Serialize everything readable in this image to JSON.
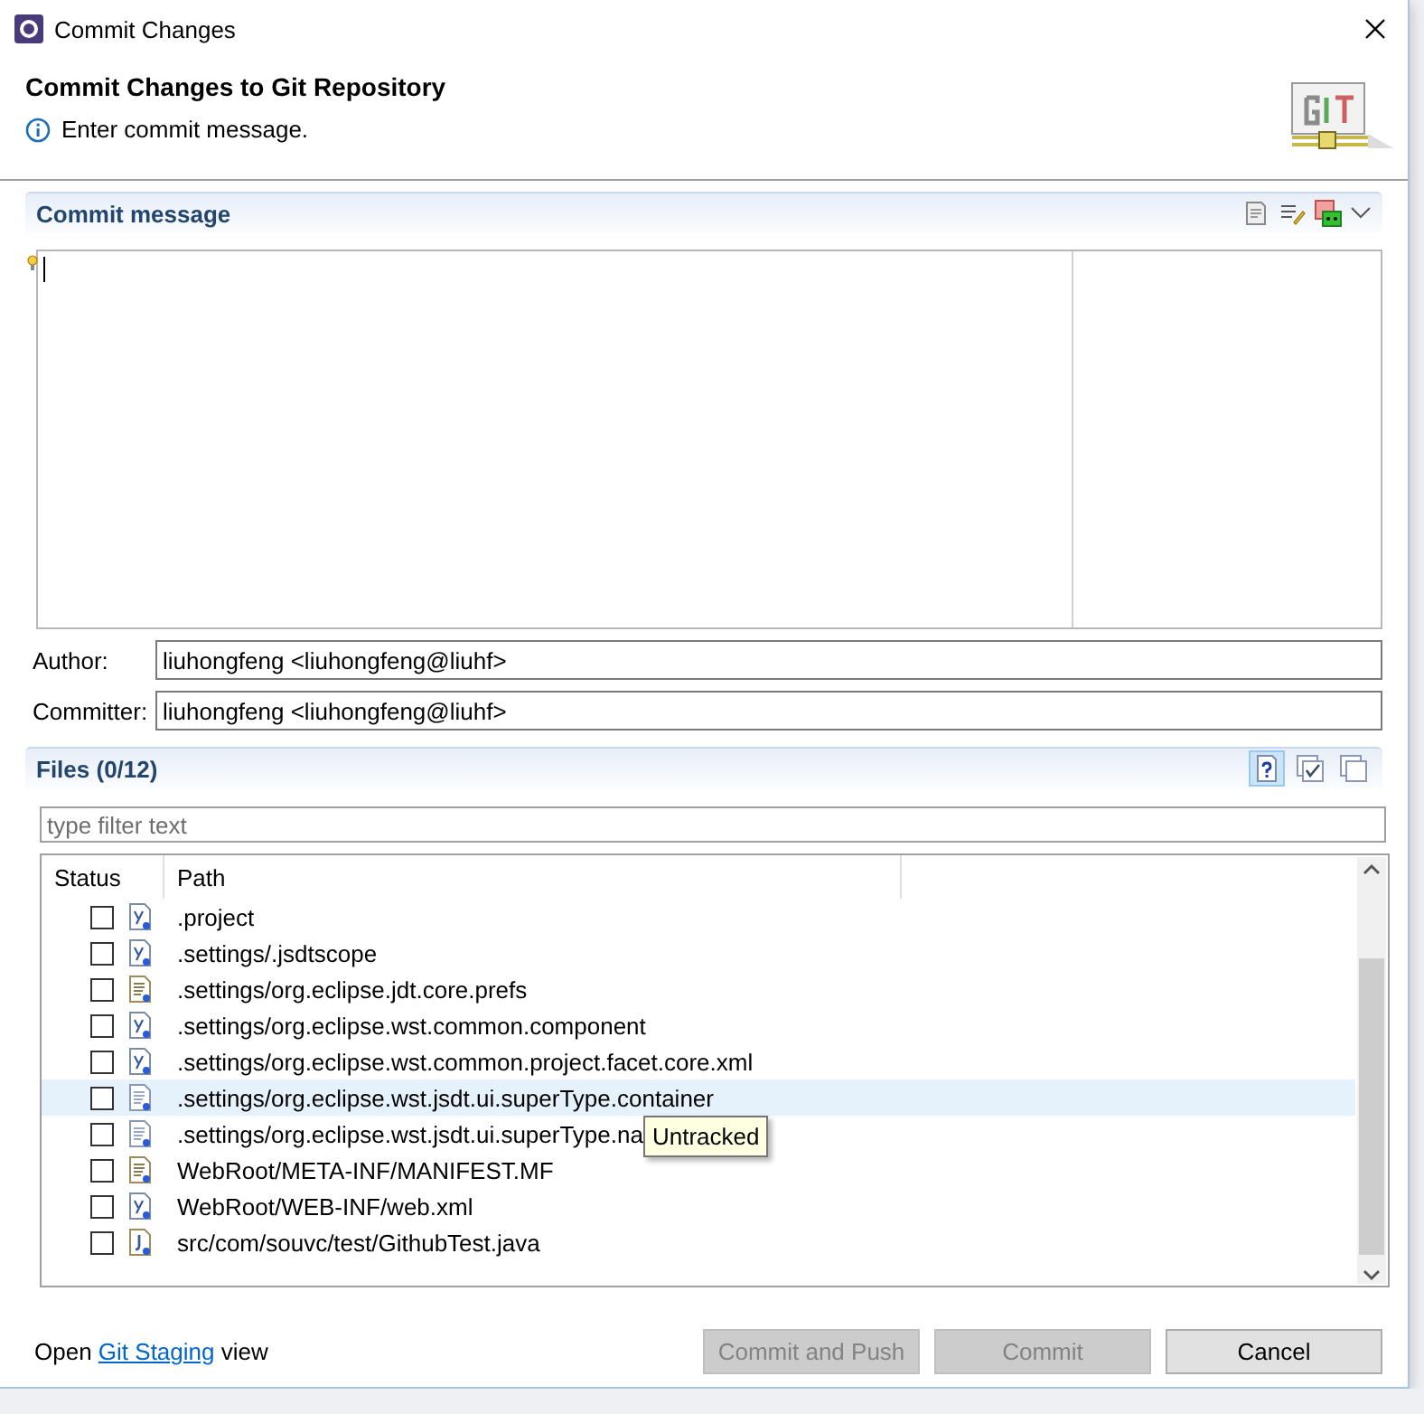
{
  "window": {
    "title": "Commit Changes"
  },
  "header": {
    "title": "Commit Changes to Git Repository",
    "message": "Enter commit message."
  },
  "commit_message": {
    "title": "Commit message"
  },
  "author": {
    "label": "Author:",
    "value": "liuhongfeng <liuhongfeng@liuhf>"
  },
  "committer": {
    "label": "Committer:",
    "value": "liuhongfeng <liuhongfeng@liuhf>"
  },
  "files": {
    "title": "Files (0/12)",
    "toolbar": [
      {
        "kind": "untracked",
        "selected": true
      },
      {
        "kind": "check-all",
        "selected": false
      },
      {
        "kind": "uncheck-all",
        "selected": false
      }
    ],
    "filter": {
      "placeholder": "type filter text"
    },
    "columns": [
      "Status",
      "Path"
    ],
    "rows": [
      {
        "kind": "xml",
        "path": ".project",
        "checked": false,
        "selected": false
      },
      {
        "kind": "xml",
        "path": ".settings/.jsdtscope",
        "checked": false,
        "selected": false
      },
      {
        "kind": "text",
        "path": ".settings/org.eclipse.jdt.core.prefs",
        "checked": false,
        "selected": false
      },
      {
        "kind": "xml",
        "path": ".settings/org.eclipse.wst.common.component",
        "checked": false,
        "selected": false
      },
      {
        "kind": "xml",
        "path": ".settings/org.eclipse.wst.common.project.facet.core.xml",
        "checked": false,
        "selected": false
      },
      {
        "kind": "plain",
        "path": ".settings/org.eclipse.wst.jsdt.ui.superType.container",
        "checked": false,
        "selected": true
      },
      {
        "kind": "plain",
        "path": ".settings/org.eclipse.wst.jsdt.ui.superType.na",
        "checked": false,
        "selected": false
      },
      {
        "kind": "text",
        "path": "WebRoot/META-INF/MANIFEST.MF",
        "checked": false,
        "selected": false
      },
      {
        "kind": "xml",
        "path": "WebRoot/WEB-INF/web.xml",
        "checked": false,
        "selected": false
      },
      {
        "kind": "java",
        "path": "src/com/souvc/test/GithubTest.java",
        "checked": false,
        "selected": false
      }
    ],
    "tooltip": "Untracked"
  },
  "footer": {
    "prefix": "Open",
    "link": "Git Staging",
    "suffix": "view"
  },
  "buttons": [
    {
      "label": "Commit and Push",
      "disabled": true
    },
    {
      "label": "Commit",
      "disabled": true
    },
    {
      "label": "Cancel",
      "disabled": false
    }
  ]
}
